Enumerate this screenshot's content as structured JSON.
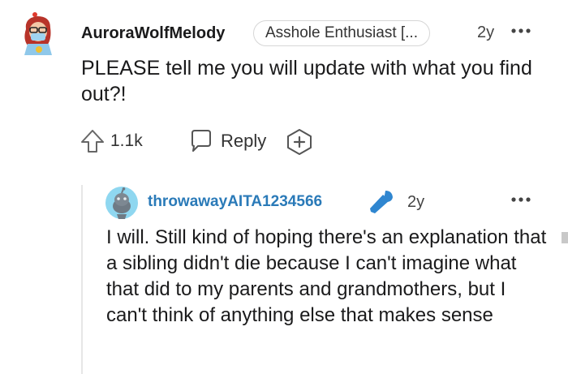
{
  "comment": {
    "username": "AuroraWolfMelody",
    "flair": "Asshole Enthusiast [...",
    "age": "2y",
    "text": "PLEASE tell me you will update with what you find out?!",
    "votes": "1.1k",
    "reply_label": "Reply"
  },
  "reply": {
    "username": "throwawayAITA1234566",
    "age": "2y",
    "text": "I will. Still kind of hoping there's an explanation that a sibling didn't die because I can't imagine what that did to my parents and grandmothers, but I can't think of anything else that makes sense"
  },
  "icons": {
    "upvote": "upvote-arrow-icon",
    "reply": "speech-bubble-icon",
    "award": "add-award-icon",
    "more": "more-dots-icon",
    "op_badge": "microphone-icon"
  },
  "colors": {
    "reply_username": "#2a7ab8",
    "mic": "#2f86d0"
  }
}
